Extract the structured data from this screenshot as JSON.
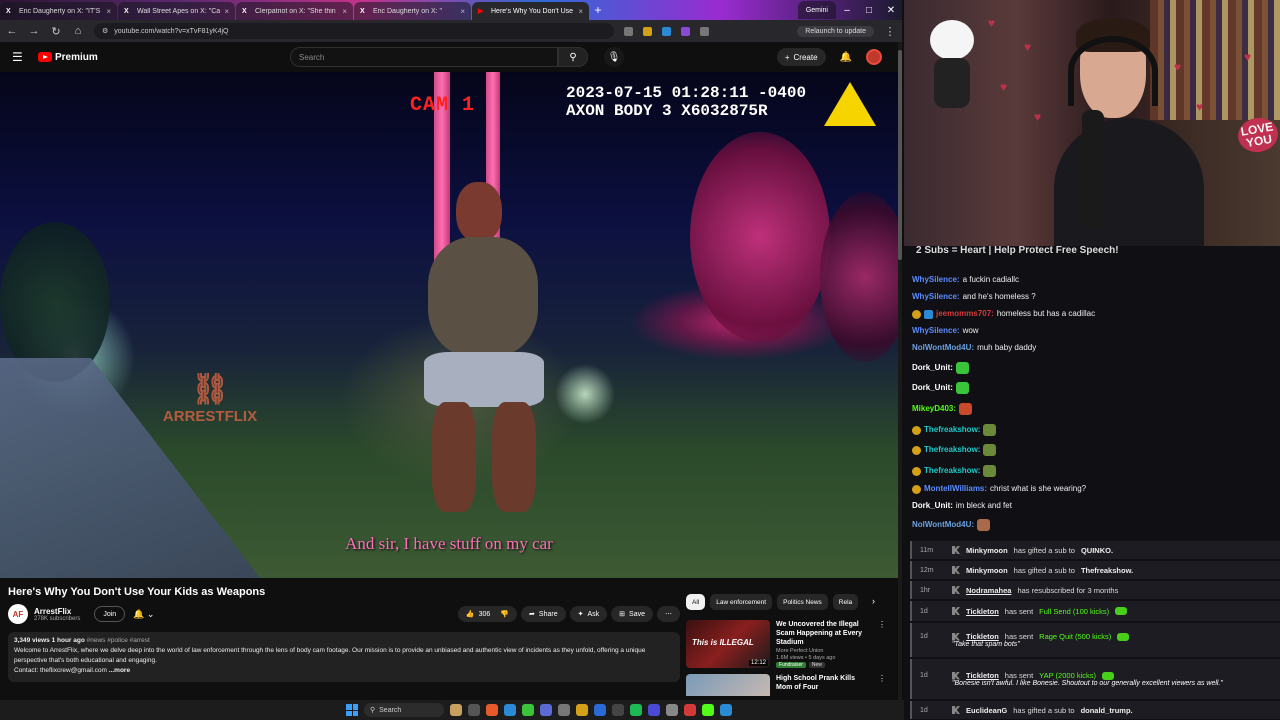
{
  "browser": {
    "tabs": [
      {
        "title": "Eric Daugherty on X: \"IT'S"
      },
      {
        "title": "Wall Street Apes on X: \"Ca"
      },
      {
        "title": "Clerpatriot on X: \"She thin"
      },
      {
        "title": "Eric Daugherty on X: \""
      },
      {
        "title": "Here's Why You Don't Use"
      }
    ],
    "new_tab": "+",
    "gemini_tab": "Gemini",
    "url": "youtube.com/watch?v=xTvF81yK4jQ",
    "relaunch": "Relaunch to update"
  },
  "youtube": {
    "logo_text": "Premium",
    "search_placeholder": "Search",
    "create_label": "Create"
  },
  "video": {
    "cam_label": "CAM 1",
    "timestamp": "2023-07-15 01:28:11 -0400",
    "camera_id": "AXON BODY 3 X6032875R",
    "watermark": "ARRESTFLIX",
    "subtitle": "And sir, I have stuff on my car",
    "title": "Here's Why You Don't Use Your Kids as Weapons",
    "channel_name": "ArrestFlix",
    "channel_subs": "278K subscribers",
    "join_label": "Join",
    "likes": "306",
    "share_label": "Share",
    "ask_label": "Ask",
    "save_label": "Save",
    "views_time": "3,349 views  1 hour ago",
    "hashtags": "#news #police #arrest",
    "description": "Welcome to ArrestFlix, where we delve deep into the world of law enforcement through the lens of body cam footage. Our mission is to provide an unbiased and authentic view of incidents as they unfold, offering a unique perspective that's both educational and engaging.",
    "contact": "Contact: theflixcrew@gmail.com",
    "more": "...more"
  },
  "recommendations": {
    "chips": [
      "All",
      "Law enforcement",
      "Politics News",
      "Rela"
    ],
    "items": [
      {
        "title": "We Uncovered the Illegal Scam Happening at Every Stadium",
        "channel": "More Perfect Union",
        "meta": "1.6M views • 5 days ago",
        "badges": [
          "Fundraiser",
          "New"
        ],
        "duration": "12:12",
        "thumb_text": "This is ILLEGAL"
      },
      {
        "title": "High School Prank Kills Mom of Four",
        "channel": "",
        "meta": "",
        "badges": [],
        "duration": "",
        "thumb_text": ""
      }
    ]
  },
  "chat": {
    "banner": "2 Subs = Heart | Help Protect Free Speech!",
    "messages": [
      {
        "user": "WhySilence:",
        "text": "a fuckin cadiallc",
        "color": "#5b8cff"
      },
      {
        "user": "WhySilence:",
        "text": "and he's homeless ?",
        "color": "#5b8cff"
      },
      {
        "user": "jeemomms707:",
        "text": "homeless but has a cadillac",
        "color": "#d63a3a"
      },
      {
        "user": "WhySilence:",
        "text": "wow",
        "color": "#5b8cff"
      },
      {
        "user": "NolWontMod4U:",
        "text": "muh baby daddy",
        "color": "#6aa0e0"
      },
      {
        "user": "Dork_Unit:",
        "text": "",
        "color": "#ffffff"
      },
      {
        "user": "Dork_Unit:",
        "text": "",
        "color": "#ffffff"
      },
      {
        "user": "MikeyD403:",
        "text": "",
        "color": "#53fc18"
      },
      {
        "user": "Thefreakshow:",
        "text": "",
        "color": "#1fc8c8"
      },
      {
        "user": "Thefreakshow:",
        "text": "",
        "color": "#1fc8c8"
      },
      {
        "user": "Thefreakshow:",
        "text": "",
        "color": "#1fc8c8"
      },
      {
        "user": "MontellWilliams:",
        "text": "christ what is she wearing?",
        "color": "#5b8cff"
      },
      {
        "user": "Dork_Unit:",
        "text": "im bleck and fet",
        "color": "#ffffff"
      },
      {
        "user": "NolWontMod4U:",
        "text": "",
        "color": "#6aa0e0"
      }
    ],
    "events": [
      {
        "time": "11m",
        "user": "Minkymoon",
        "text": "has gifted a sub to",
        "target": "QUINKO.",
        "amount": "",
        "note": ""
      },
      {
        "time": "12m",
        "user": "Minkymoon",
        "text": "has gifted a sub to",
        "target": "Thefreakshow.",
        "amount": "",
        "note": ""
      },
      {
        "time": "1hr",
        "user": "Nodramahea",
        "text": "has resubscribed for 3 months",
        "target": "",
        "amount": "",
        "note": ""
      },
      {
        "time": "1d",
        "user": "Tickleton",
        "text": "has sent",
        "target": "",
        "amount": "Full Send (100 kicks)",
        "note": ""
      },
      {
        "time": "1d",
        "user": "Tickleton",
        "text": "has sent",
        "target": "",
        "amount": "Rage Quit (500 kicks)",
        "note": "\"Take that spam bots\""
      },
      {
        "time": "1d",
        "user": "Tickleton",
        "text": "has sent",
        "target": "",
        "amount": "YAP (2000 kicks)",
        "note": "\"Bonesie isn't awful. I like Bonesie. Shoutout to our generally excellent viewers as well.\""
      },
      {
        "time": "1d",
        "user": "EuclideanG",
        "text": "has gifted a sub to",
        "target": "donald_trump.",
        "amount": "",
        "note": ""
      }
    ]
  },
  "webcam": {
    "sign": "LOVE YOU"
  },
  "taskbar": {
    "search": "Search"
  }
}
